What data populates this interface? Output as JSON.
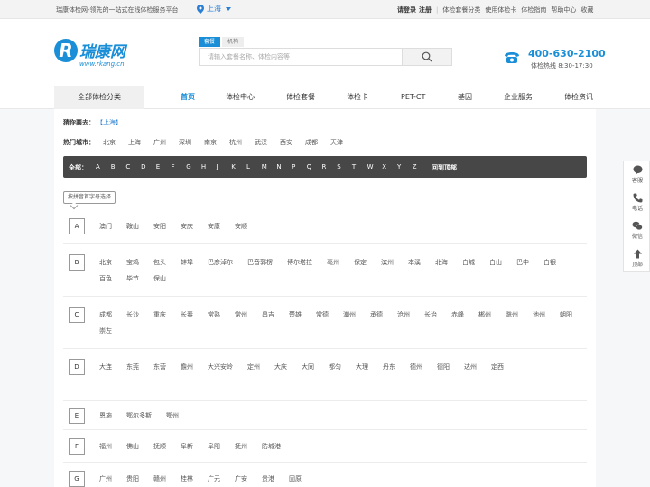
{
  "topbar": {
    "slogan": "瑞康体检网-领先的一站式在线体检服务平台",
    "location": "上海",
    "login": "请登录",
    "register": "注册",
    "links": [
      "体检套餐分类",
      "使用体检卡",
      "体检指南",
      "帮助中心",
      "收藏"
    ]
  },
  "header": {
    "brand": "瑞康网",
    "domain": "www.rkang.cn",
    "search_tabs": [
      "套餐",
      "机构"
    ],
    "search_placeholder": "请输入套餐名称、体检内容等",
    "phone": "400-630-2100",
    "hours": "体检热线 8:30-17:30"
  },
  "nav": {
    "all_categories": "全部体检分类",
    "items": [
      "首页",
      "体检中心",
      "体检套餐",
      "体检卡",
      "PET-CT",
      "基因",
      "企业服务",
      "体检资讯"
    ]
  },
  "guess": {
    "label": "猜你要去：",
    "city": "【上海】"
  },
  "hot": {
    "label": "热门城市：",
    "cities": [
      "北京",
      "上海",
      "广州",
      "深圳",
      "南京",
      "杭州",
      "武汉",
      "西安",
      "成都",
      "天津"
    ]
  },
  "letterbar": {
    "all": "全部：",
    "letters": [
      "A",
      "B",
      "C",
      "D",
      "E",
      "F",
      "G",
      "H",
      "J",
      "K",
      "L",
      "M",
      "N",
      "P",
      "Q",
      "R",
      "S",
      "T",
      "W",
      "X",
      "Y",
      "Z"
    ],
    "back_top": "回到顶部"
  },
  "hint": "按拼音首字母选择",
  "groups": [
    {
      "letter": "A",
      "cities": [
        "澳门",
        "鞍山",
        "安阳",
        "安庆",
        "安康",
        "安顺"
      ]
    },
    {
      "letter": "B",
      "cities": [
        "北京",
        "宝鸡",
        "包头",
        "蚌埠",
        "巴彦淖尔",
        "巴音郭楞",
        "博尔塔拉",
        "亳州",
        "保定",
        "滨州",
        "本溪",
        "北海",
        "白城",
        "白山",
        "巴中",
        "白银",
        "百色",
        "毕节",
        "保山"
      ]
    },
    {
      "letter": "C",
      "cities": [
        "成都",
        "长沙",
        "重庆",
        "长春",
        "常熟",
        "常州",
        "昌吉",
        "楚雄",
        "常德",
        "潮州",
        "承德",
        "沧州",
        "长治",
        "赤峰",
        "郴州",
        "滁州",
        "池州",
        "朝阳",
        "崇左"
      ]
    },
    {
      "letter": "D",
      "cities": [
        "大连",
        "东莞",
        "东营",
        "儋州",
        "大兴安岭",
        "定州",
        "大庆",
        "大同",
        "都匀",
        "大理",
        "丹东",
        "德州",
        "德阳",
        "达州",
        "定西"
      ]
    },
    {
      "letter": "E",
      "cities": [
        "恩施",
        "鄂尔多斯",
        "鄂州"
      ]
    },
    {
      "letter": "F",
      "cities": [
        "福州",
        "佛山",
        "抚顺",
        "阜新",
        "阜阳",
        "抚州",
        "防城港"
      ]
    },
    {
      "letter": "G",
      "cities": [
        "广州",
        "贵阳",
        "赣州",
        "桂林",
        "广元",
        "广安",
        "贵港",
        "固原"
      ]
    }
  ],
  "float": [
    "客服",
    "电话",
    "微信",
    "顶部"
  ],
  "colors": {
    "accent": "#1a8fd8",
    "letterbar": "#474747"
  }
}
